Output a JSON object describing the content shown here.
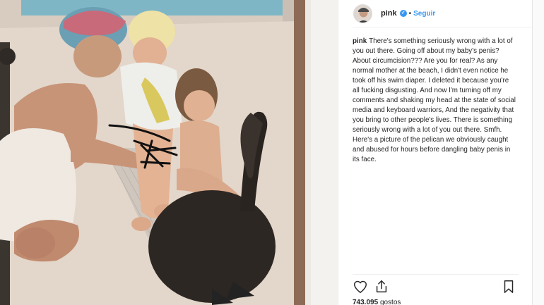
{
  "post": {
    "author": {
      "username": "pink",
      "verified": true,
      "verified_icon": "verified-badge-icon",
      "avatar_icon": "avatar"
    },
    "header": {
      "separator": "•",
      "follow_label": "Seguir"
    },
    "caption": {
      "username": "pink",
      "text": "There's something seriously wrong with a lot of you out there. Going off about my baby's penis? About circumcision??? Are you for real? As any normal mother at the beach, I didn't even notice he took off his swim diaper. I deleted it because you're all fucking disgusting. And now I'm turning off my comments and shaking my head at the state of social media and keyboard warriors, And the negativity that you bring to other people's lives. There is something seriously wrong with a lot of you out there. Smfh. Here's a picture of the pelican we obviously caught and abused for hours before dangling baby penis in its face."
    },
    "actions": {
      "like_icon": "heart-icon",
      "share_icon": "share-icon",
      "save_icon": "bookmark-icon"
    },
    "likes": {
      "count": "743.095",
      "label": "gostos"
    },
    "photo": {
      "subject_icon": "pelican",
      "censor_icon": "scribble-censor"
    },
    "colors": {
      "accent": "#3897f0",
      "text": "#262626",
      "divider": "#efefef"
    }
  }
}
